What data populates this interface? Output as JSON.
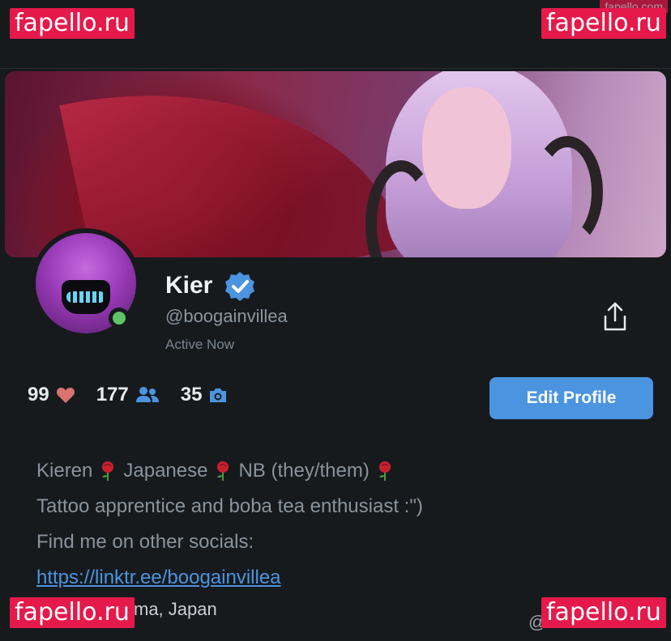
{
  "watermark_text": "fapello.ru",
  "watermark_top_right_small": "fapello.com",
  "profile": {
    "name": "Kier",
    "handle": "@boogainvillea",
    "status": "Active Now"
  },
  "stats": [
    {
      "value": "99",
      "icon": "heart-icon"
    },
    {
      "value": "177",
      "icon": "users-icon"
    },
    {
      "value": "35",
      "icon": "camera-icon"
    }
  ],
  "edit_button_label": "Edit Profile",
  "bio": {
    "line1_parts": [
      "Kieren",
      "Japanese",
      "NB (they/them)"
    ],
    "line2": "Tattoo apprentice and boba tea enthusiast :\")",
    "line3": "Find me on other socials:",
    "link": "https://linktr.ee/boogainvillea",
    "location": "ma, Japan"
  },
  "bottom_right_partial": "@",
  "colors": {
    "accent": "#4b94e0",
    "online": "#5ec46a",
    "heart": "#d8736f",
    "watermark": "#e6194b",
    "background": "#161a1d"
  }
}
